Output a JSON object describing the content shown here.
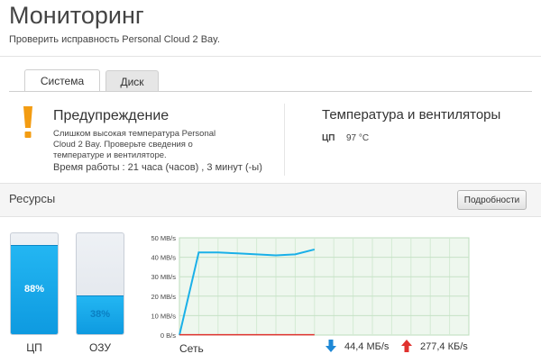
{
  "header": {
    "title": "Мониторинг",
    "subtitle": "Проверить исправность Personal Cloud 2 Bay."
  },
  "tabs": [
    {
      "label": "Система",
      "active": true
    },
    {
      "label": "Диск",
      "active": false
    }
  ],
  "warning": {
    "icon": "exclamation-icon",
    "color": "#f39c12",
    "title": "Предупреждение",
    "text": "Слишком высокая температура Personal Cloud 2 Bay. Проверьте сведения о температуре и вентиляторе.",
    "uptime": "Время работы : 21 часа (часов) , 3 минут (-ы)"
  },
  "temperature": {
    "title": "Температура и вентиляторы",
    "cpu_label": "ЦП",
    "cpu_value": "97 °C"
  },
  "resources": {
    "title": "Ресурсы",
    "details_button": "Подробности",
    "cpu": {
      "label": "ЦП",
      "percent_text": "88%",
      "percent": 88
    },
    "ram": {
      "label": "ОЗУ",
      "percent_text": "38%",
      "percent": 38
    },
    "network": {
      "label": "Сеть",
      "download_icon": "arrow-down-icon",
      "download_color": "#1e88d6",
      "download": "44,4 МБ/s",
      "upload_icon": "arrow-up-icon",
      "upload_color": "#e0322e",
      "upload": "277,4 КБ/s"
    }
  },
  "chart_data": {
    "type": "line",
    "y_ticks": [
      "50 MB/s",
      "40 MB/s",
      "30 MB/s",
      "20 MB/s",
      "10 MB/s",
      "0 B/s"
    ],
    "ylim": [
      0,
      50
    ],
    "xlim": [
      0,
      15
    ],
    "grid": true,
    "series": [
      {
        "color": "#1ab0e8",
        "x": [
          0,
          1,
          2,
          3,
          4,
          5,
          6,
          7
        ],
        "y": [
          0,
          42.5,
          42.5,
          42,
          41.5,
          41,
          41.5,
          44
        ]
      },
      {
        "color": "#e0322e",
        "x": [
          0,
          7
        ],
        "y": [
          0.2,
          0.2
        ]
      }
    ]
  }
}
